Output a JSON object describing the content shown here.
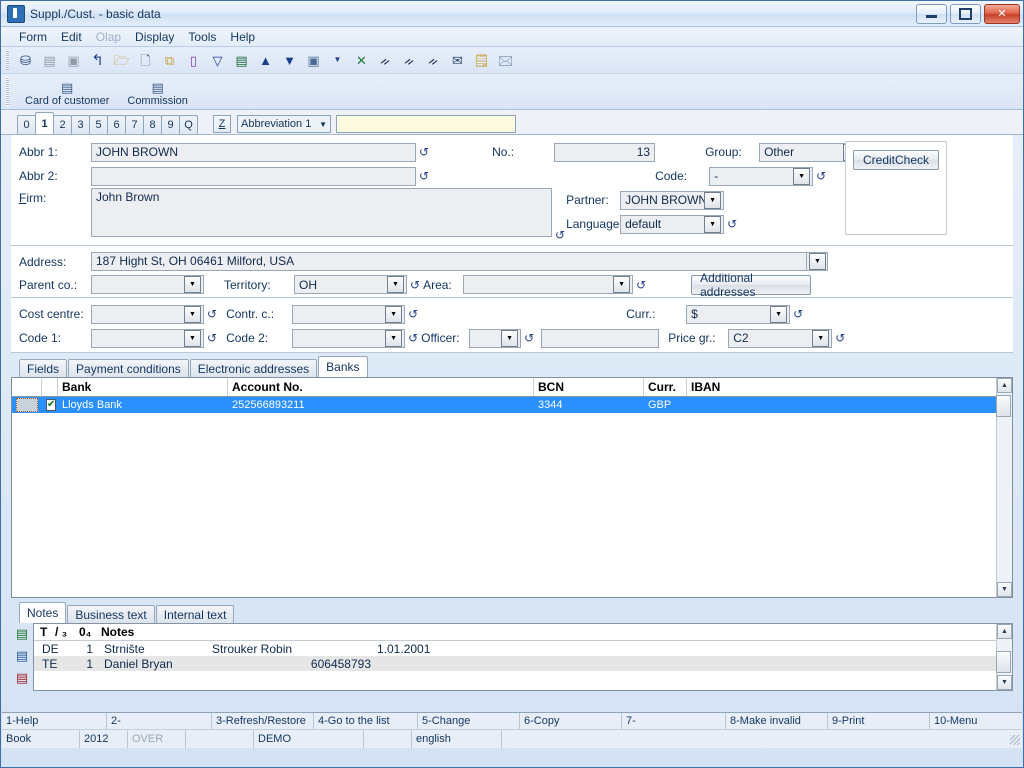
{
  "window": {
    "title": "Suppl./Cust. - basic data",
    "app_icon": "app-window-icon",
    "minimize": "–",
    "maximize": "□",
    "close": "✕"
  },
  "menu": {
    "items": [
      {
        "label": "Form",
        "disabled": false
      },
      {
        "label": "Edit",
        "disabled": false
      },
      {
        "label": "Olap",
        "disabled": true
      },
      {
        "label": "Display",
        "disabled": false
      },
      {
        "label": "Tools",
        "disabled": false
      },
      {
        "label": "Help",
        "disabled": false
      }
    ]
  },
  "toolbar": {
    "icons": [
      {
        "name": "tree-structure-icon",
        "glyph": "⛁"
      },
      {
        "name": "save-icon",
        "glyph": "▤"
      },
      {
        "name": "save-as-icon",
        "glyph": "▣"
      },
      {
        "name": "undo-icon",
        "glyph": "↰"
      },
      {
        "name": "open-folder-icon",
        "glyph": "📂"
      },
      {
        "name": "new-document-icon",
        "glyph": "🗋"
      },
      {
        "name": "copy-icon",
        "glyph": "⧉"
      },
      {
        "name": "book-icon",
        "glyph": "📖"
      },
      {
        "name": "filter-icon",
        "glyph": "▽"
      },
      {
        "name": "filter-list-icon",
        "glyph": "▤"
      },
      {
        "name": "move-up-icon",
        "glyph": "▲"
      },
      {
        "name": "move-down-icon",
        "glyph": "▼"
      },
      {
        "name": "camera-icon",
        "glyph": "▣"
      },
      {
        "name": "dropdown-arrow-icon",
        "glyph": "▾"
      },
      {
        "name": "export-excel-icon",
        "glyph": "✕"
      },
      {
        "name": "find-icon",
        "glyph": "⚲"
      },
      {
        "name": "find-next-icon",
        "glyph": "⚲"
      },
      {
        "name": "find-prev-icon",
        "glyph": "⚲"
      },
      {
        "name": "mail-icon",
        "glyph": "✉"
      },
      {
        "name": "edit-note-icon",
        "glyph": "🗒"
      },
      {
        "name": "mail-note-icon",
        "glyph": "🖂"
      }
    ],
    "big_buttons": [
      {
        "name": "card-of-customer-button",
        "label": "Card of customer",
        "icon": "document-icon"
      },
      {
        "name": "commission-button",
        "label": "Commission",
        "icon": "document-icon"
      }
    ]
  },
  "numstrip": {
    "tabs": [
      "0",
      "1",
      "2",
      "3",
      "5",
      "6",
      "7",
      "8",
      "9",
      "Q"
    ],
    "active": "1",
    "z_button": "Z",
    "selector_value": "Abbreviation 1",
    "search_value": "",
    "search_placeholder": ""
  },
  "form": {
    "abbr1": {
      "label": "Abbr 1:",
      "value": "JOHN BROWN"
    },
    "abbr2": {
      "label": "Abbr 2:",
      "value": ""
    },
    "firm": {
      "label": "Firm:",
      "value": "John Brown"
    },
    "no": {
      "label": "No.:",
      "value": "13"
    },
    "group": {
      "label": "Group:",
      "value": "Other"
    },
    "code": {
      "label": "Code:",
      "value": "-"
    },
    "partner": {
      "label": "Partner:",
      "value": "JOHN BROWN"
    },
    "language": {
      "label": "Language:",
      "value": "default"
    },
    "credit_check": "CreditCheck",
    "address": {
      "label": "Address:",
      "value": "187  Hight St, OH 06461 Milford, USA"
    },
    "parent_co": {
      "label": "Parent co.:",
      "value": ""
    },
    "territory": {
      "label": "Territory:",
      "value": "OH"
    },
    "area": {
      "label": "Area:",
      "value": ""
    },
    "additional_addresses": "Additional addresses",
    "cost_centre": {
      "label": "Cost centre:",
      "value": ""
    },
    "contr_c": {
      "label": "Contr. c.:",
      "value": ""
    },
    "curr": {
      "label": "Curr.:",
      "value": "$"
    },
    "code1": {
      "label": "Code 1:",
      "value": ""
    },
    "code2": {
      "label": "Code 2:",
      "value": ""
    },
    "officer": {
      "label": "Officer:",
      "value": ""
    },
    "officer_extra": {
      "value": ""
    },
    "price_gr": {
      "label": "Price gr.:",
      "value": "C2"
    }
  },
  "detail_tabs": {
    "items": [
      "Fields",
      "Payment conditions",
      "Electronic addresses",
      "Banks"
    ],
    "active": "Banks"
  },
  "banks_grid": {
    "columns": [
      "",
      "",
      "Bank",
      "Account No.",
      "BCN",
      "Curr.",
      "IBAN"
    ],
    "rows": [
      {
        "checked": "✔",
        "bank": "Lloyds Bank",
        "account_no": "252566893211",
        "bcn": "3344",
        "curr": "GBP",
        "iban": ""
      }
    ]
  },
  "notes_tabs": {
    "items": [
      "Notes",
      "Business text",
      "Internal text"
    ],
    "active": "Notes"
  },
  "notes_side_icons": [
    {
      "name": "note-add-icon",
      "glyph": "🗎"
    },
    {
      "name": "note-edit-icon",
      "glyph": "🗎"
    },
    {
      "name": "note-delete-icon",
      "glyph": "🗎"
    }
  ],
  "notes_list": {
    "columns": [
      "T",
      "/",
      "3",
      "0",
      "4",
      "Notes"
    ],
    "header": {
      "t": "T",
      "slash": "/ ₃",
      "o": "0₄",
      "notes": "Notes"
    },
    "rows": [
      {
        "type": "DE",
        "num": "1",
        "text": "Strnište",
        "name": "Strouker Robin",
        "extra": "1.01.2001"
      },
      {
        "type": "TE",
        "num": "1",
        "text": "Daniel Bryan",
        "name": "606458793",
        "extra": ""
      }
    ]
  },
  "fkeys": [
    "1-Help",
    "2-",
    "3-Refresh/Restore",
    "4-Go to the list",
    "5-Change",
    "6-Copy",
    "7-",
    "8-Make invalid",
    "9-Print",
    "10-Menu"
  ],
  "statusbar": {
    "book": "Book",
    "year": "2012",
    "over": "OVER",
    "blank1": "",
    "demo": "DEMO",
    "blank2": "",
    "language": "english",
    "blank3": ""
  },
  "colors": {
    "accent": "#2a8fff",
    "title_text": "#16365e",
    "label": "#12355f",
    "field_bg": "#eceef1",
    "search_bg": "#fdfbdf",
    "close_btn": "#c8422a"
  }
}
